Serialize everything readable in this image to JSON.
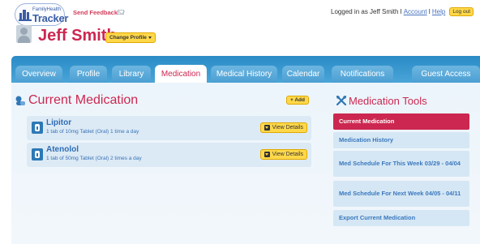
{
  "logo": {
    "top_text": "FamilyHealth",
    "main_text": "Tracker"
  },
  "header": {
    "send_feedback": "Send Feedback",
    "logged_in_text": "Logged in as Jeff Smith",
    "separator": "I",
    "account_link": "Account",
    "help_link": "Help",
    "logout_label": "Log out"
  },
  "profile": {
    "name": "Jeff Smith",
    "change_profile_label": "Change Profile"
  },
  "tabs": [
    {
      "label": "Overview"
    },
    {
      "label": "Profile"
    },
    {
      "label": "Library"
    },
    {
      "label": "Medication",
      "active": true
    },
    {
      "label": "Medical History"
    },
    {
      "label": "Calendar"
    },
    {
      "label": "Notifications"
    },
    {
      "label": "Guest Access"
    }
  ],
  "current_medication": {
    "title": "Current Medication",
    "add_label": "+ Add",
    "items": [
      {
        "name": "Lipitor",
        "dose": "1 tab of 10mg Tablet (Oral) 1 time a day",
        "button": "View Details"
      },
      {
        "name": "Atenolol",
        "dose": "1 tab of 50mg Tablet (Oral) 2 times a day",
        "button": "View Details"
      }
    ]
  },
  "tools": {
    "title": "Medication Tools",
    "items": [
      {
        "label": "Current Medication",
        "active": true
      },
      {
        "label": "Medication History"
      },
      {
        "label": "Med Schedule For This Week 03/29 - 04/04"
      },
      {
        "label": "Med Schedule For Next Week 04/05 - 04/11"
      },
      {
        "label": "Export Current Medication"
      }
    ]
  },
  "colors": {
    "accent": "#cc2750",
    "tab_bar": "#2a8bc6",
    "button": "#ffd84a",
    "link": "#4a74c0"
  }
}
